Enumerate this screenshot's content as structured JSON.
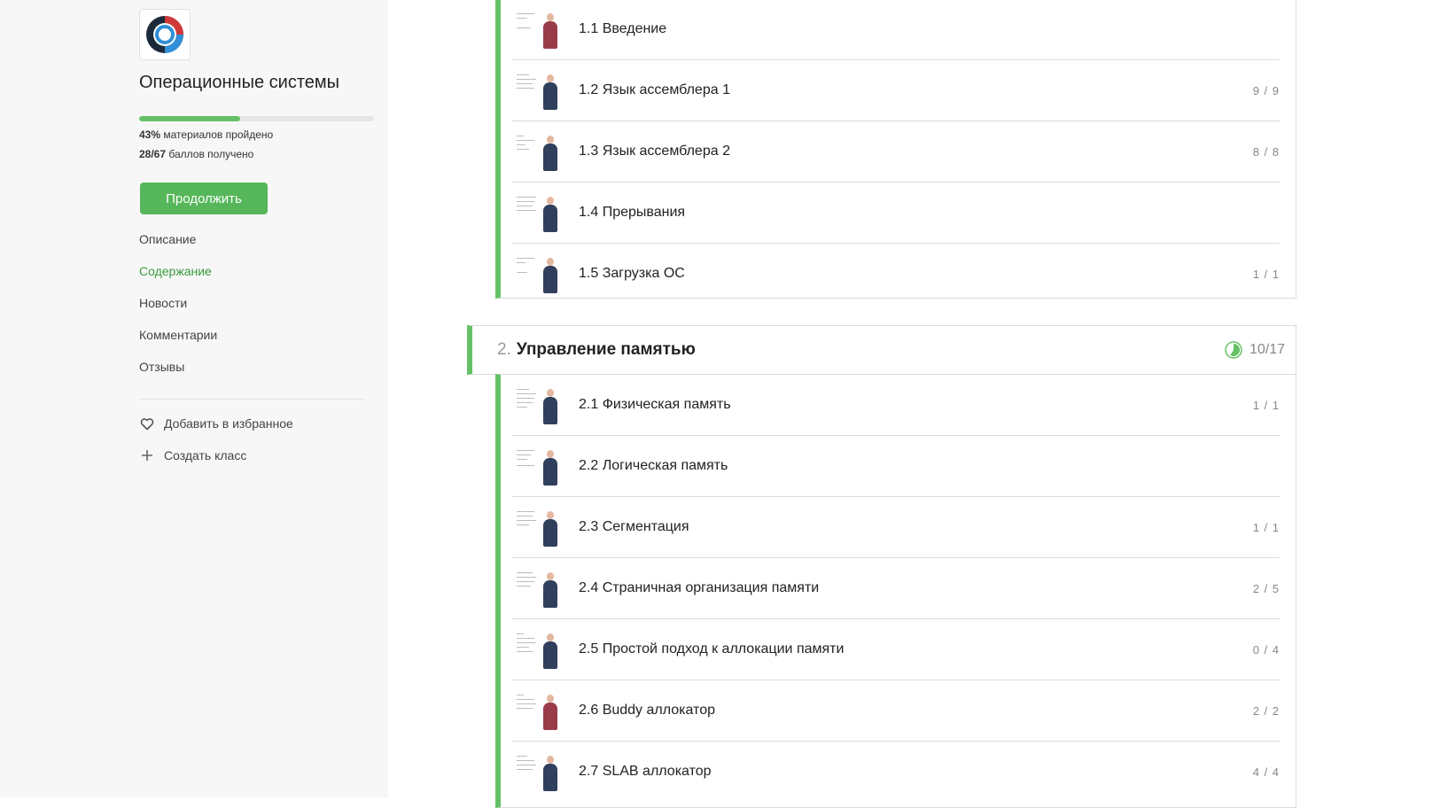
{
  "sidebar": {
    "course_title": "Операционные системы",
    "progress_fraction": 0.43,
    "materials_pct": "43%",
    "materials_label": "материалов пройдено",
    "points": "28/67",
    "points_label": "баллов получено",
    "continue_label": "Продолжить",
    "nav": [
      {
        "label": "Описание",
        "active": false
      },
      {
        "label": "Содержание",
        "active": true
      },
      {
        "label": "Новости",
        "active": false
      },
      {
        "label": "Комментарии",
        "active": false
      },
      {
        "label": "Отзывы",
        "active": false
      }
    ],
    "favorite_label": "Добавить в избранное",
    "create_class_label": "Создать класс",
    "accent_color": "#55b759"
  },
  "module1_lessons": [
    {
      "title": "1.1 Введение",
      "score": "",
      "presenter": "red"
    },
    {
      "title": "1.2 Язык ассемблера 1",
      "score": "9 / 9",
      "presenter": "blue"
    },
    {
      "title": "1.3 Язык ассемблера 2",
      "score": "8 / 8",
      "presenter": "blue"
    },
    {
      "title": "1.4 Прерывания",
      "score": "",
      "presenter": "blue"
    },
    {
      "title": "1.5 Загрузка ОС",
      "score": "1 / 1",
      "presenter": "blue"
    }
  ],
  "module2": {
    "number": "2.",
    "title": "Управление памятью",
    "progress_text": "10/17",
    "progress_fraction": 0.59,
    "lessons": [
      {
        "title": "2.1 Физическая память",
        "score": "1 / 1",
        "presenter": "blue"
      },
      {
        "title": "2.2 Логическая память",
        "score": "",
        "presenter": "blue"
      },
      {
        "title": "2.3 Сегментация",
        "score": "1 / 1",
        "presenter": "blue"
      },
      {
        "title": "2.4 Страничная организация памяти",
        "score": "2 / 5",
        "presenter": "blue"
      },
      {
        "title": "2.5 Простой подход к аллокации памяти",
        "score": "0 / 4",
        "presenter": "blue"
      },
      {
        "title": "2.6 Buddy аллокатор",
        "score": "2 / 2",
        "presenter": "blue"
      },
      {
        "title": "2.7 SLAB аллокатор",
        "score": "4 / 4",
        "presenter": "blue"
      }
    ]
  }
}
